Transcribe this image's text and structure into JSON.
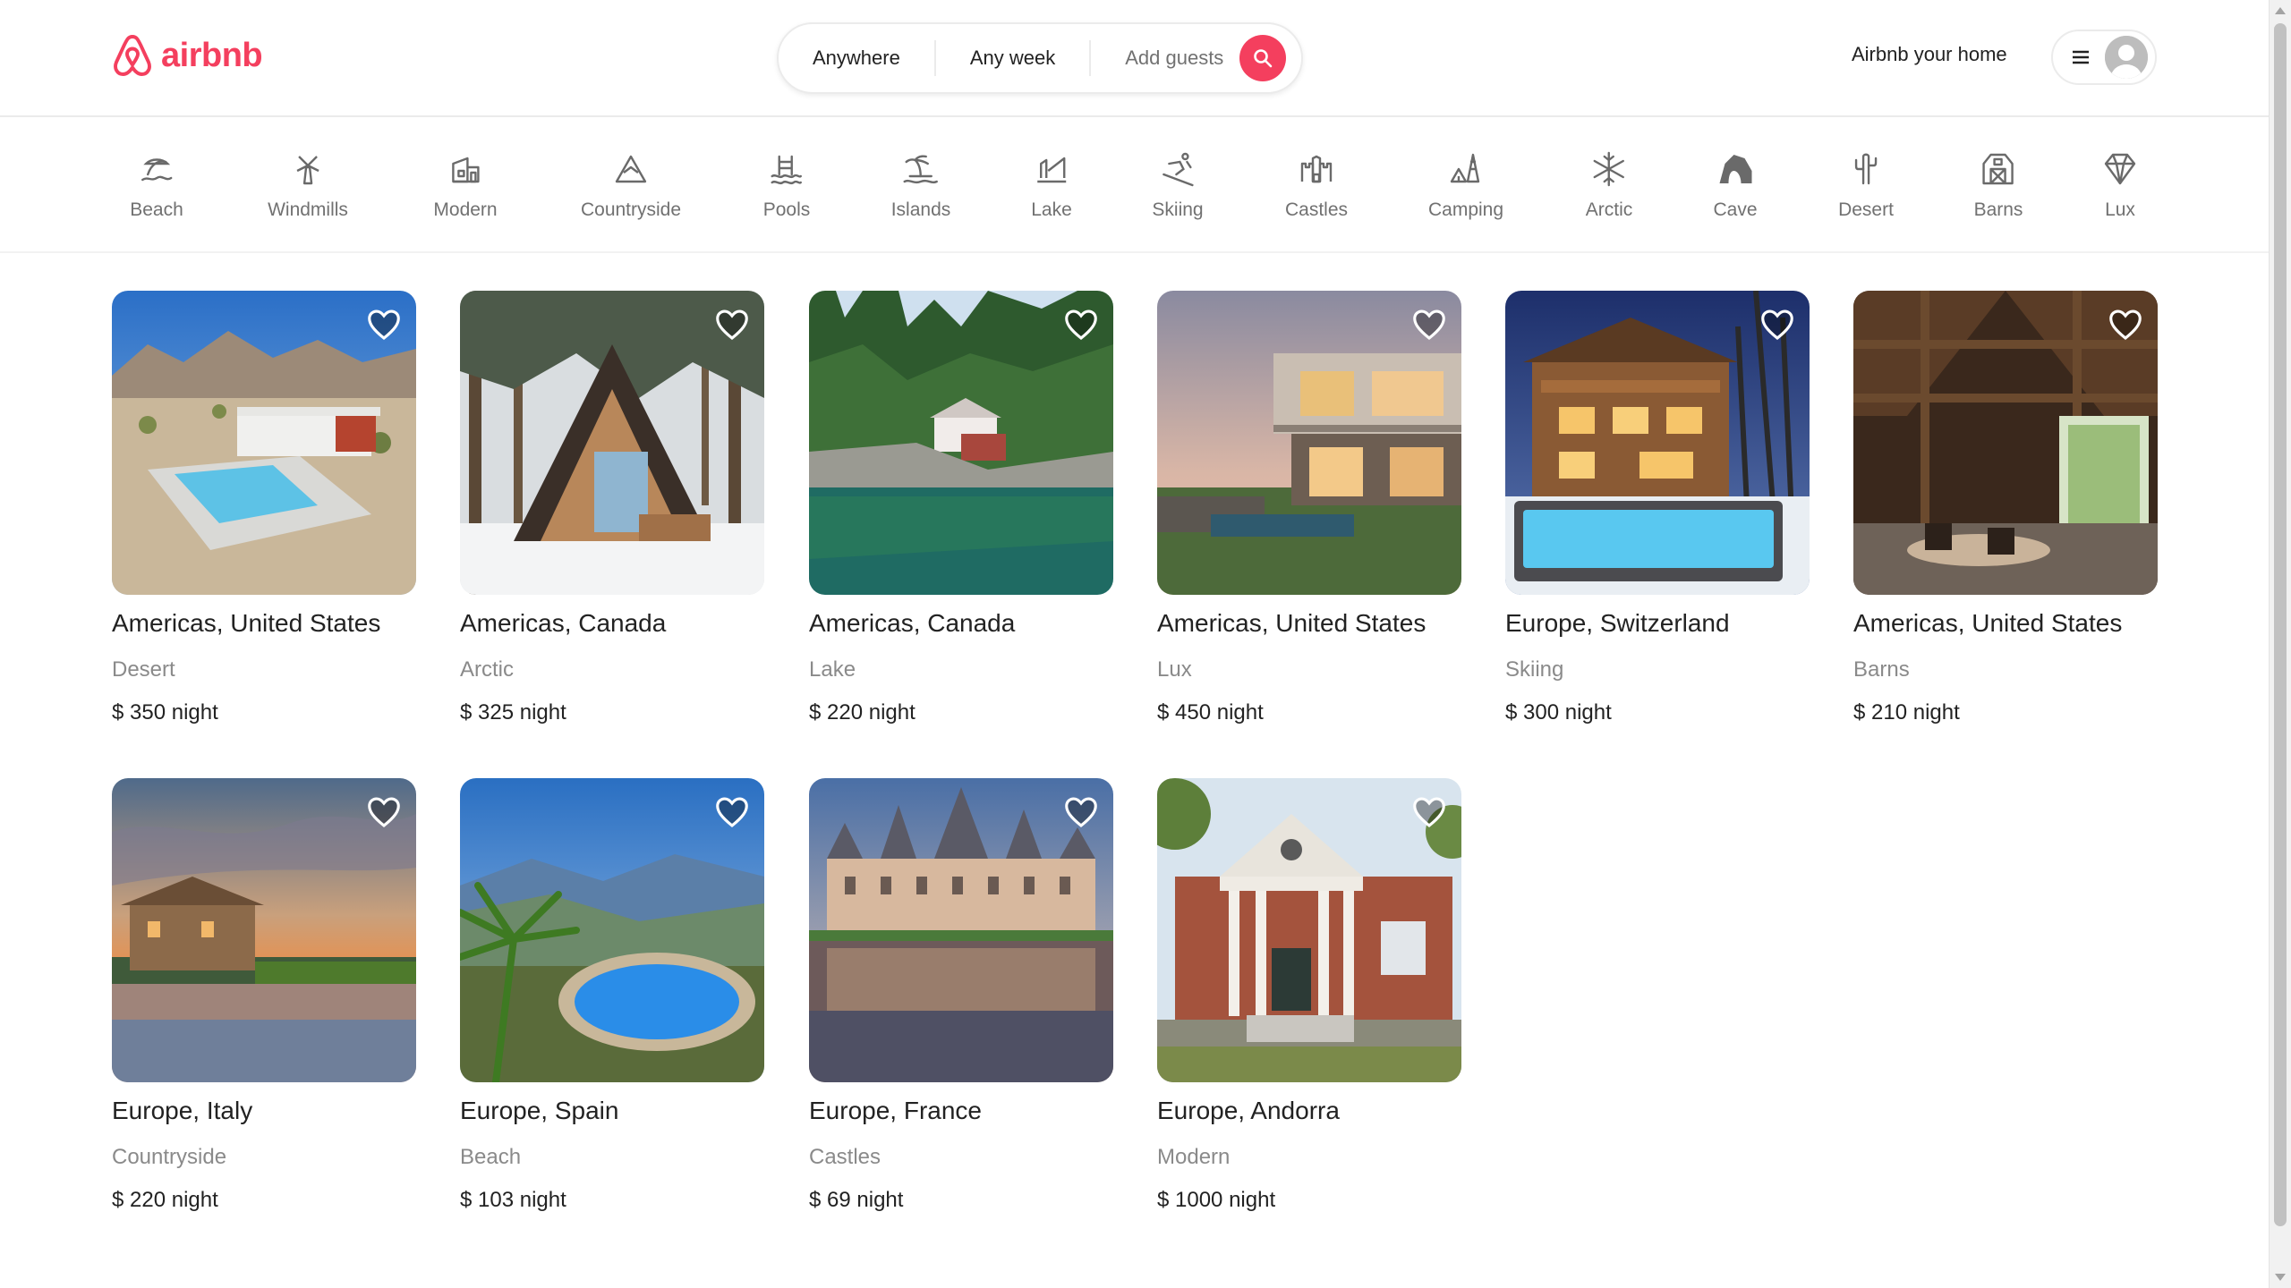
{
  "brand": {
    "name": "airbnb",
    "color": "#F43F5E"
  },
  "search": {
    "where": "Anywhere",
    "when": "Any week",
    "guests": "Add guests"
  },
  "header": {
    "host_link": "Airbnb your home"
  },
  "categories": [
    {
      "label": "Beach",
      "icon": "beach-icon"
    },
    {
      "label": "Windmills",
      "icon": "windmill-icon"
    },
    {
      "label": "Modern",
      "icon": "modern-house-icon"
    },
    {
      "label": "Countryside",
      "icon": "mountain-icon"
    },
    {
      "label": "Pools",
      "icon": "pool-icon"
    },
    {
      "label": "Islands",
      "icon": "island-icon"
    },
    {
      "label": "Lake",
      "icon": "lake-icon"
    },
    {
      "label": "Skiing",
      "icon": "skiing-icon"
    },
    {
      "label": "Castles",
      "icon": "castle-icon"
    },
    {
      "label": "Camping",
      "icon": "camping-icon"
    },
    {
      "label": "Arctic",
      "icon": "snowflake-icon"
    },
    {
      "label": "Cave",
      "icon": "cave-icon"
    },
    {
      "label": "Desert",
      "icon": "cactus-icon"
    },
    {
      "label": "Barns",
      "icon": "barn-icon"
    },
    {
      "label": "Lux",
      "icon": "diamond-icon"
    }
  ],
  "listings": [
    {
      "location": "Americas, United States",
      "category": "Desert",
      "price": "$ 350",
      "unit": "night"
    },
    {
      "location": "Americas, Canada",
      "category": "Arctic",
      "price": "$ 325",
      "unit": "night"
    },
    {
      "location": "Americas, Canada",
      "category": "Lake",
      "price": "$ 220",
      "unit": "night"
    },
    {
      "location": "Americas, United States",
      "category": "Lux",
      "price": "$ 450",
      "unit": "night"
    },
    {
      "location": "Europe, Switzerland",
      "category": "Skiing",
      "price": "$ 300",
      "unit": "night"
    },
    {
      "location": "Americas, United States",
      "category": "Barns",
      "price": "$ 210",
      "unit": "night"
    },
    {
      "location": "Europe, Italy",
      "category": "Countryside",
      "price": "$ 220",
      "unit": "night"
    },
    {
      "location": "Europe, Spain",
      "category": "Beach",
      "price": "$ 103",
      "unit": "night"
    },
    {
      "location": "Europe, France",
      "category": "Castles",
      "price": "$ 69",
      "unit": "night"
    },
    {
      "location": "Europe, Andorra",
      "category": "Modern",
      "price": "$ 1000",
      "unit": "night"
    }
  ]
}
